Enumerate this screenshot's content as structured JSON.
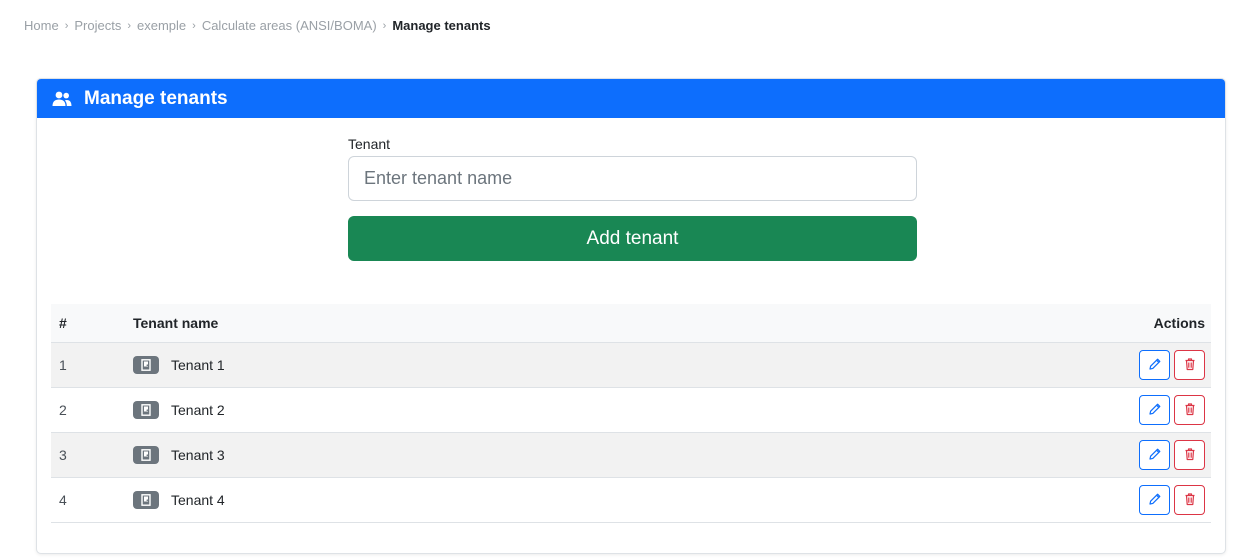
{
  "breadcrumb": {
    "items": [
      "Home",
      "Projects",
      "exemple",
      "Calculate areas (ANSI/BOMA)"
    ],
    "active": "Manage tenants",
    "separator": "›"
  },
  "card": {
    "title": "Manage tenants",
    "header_color": "#0d6efd"
  },
  "form": {
    "label": "Tenant",
    "input_value": "",
    "placeholder": "Enter tenant name",
    "add_button_label": "Add tenant",
    "button_color": "#198754"
  },
  "table": {
    "columns": [
      "#",
      "Tenant name",
      "Actions"
    ],
    "rows": [
      {
        "num": "1",
        "name": "Tenant 1"
      },
      {
        "num": "2",
        "name": "Tenant 2"
      },
      {
        "num": "3",
        "name": "Tenant 3"
      },
      {
        "num": "4",
        "name": "Tenant 4"
      }
    ]
  },
  "icons": {
    "header": "users-icon",
    "tenant_badge": "door-icon",
    "edit": "pencil-icon",
    "delete": "trash-icon"
  },
  "colors": {
    "edit": "#0d6efd",
    "delete": "#dc3545",
    "badge": "#6c757d"
  }
}
